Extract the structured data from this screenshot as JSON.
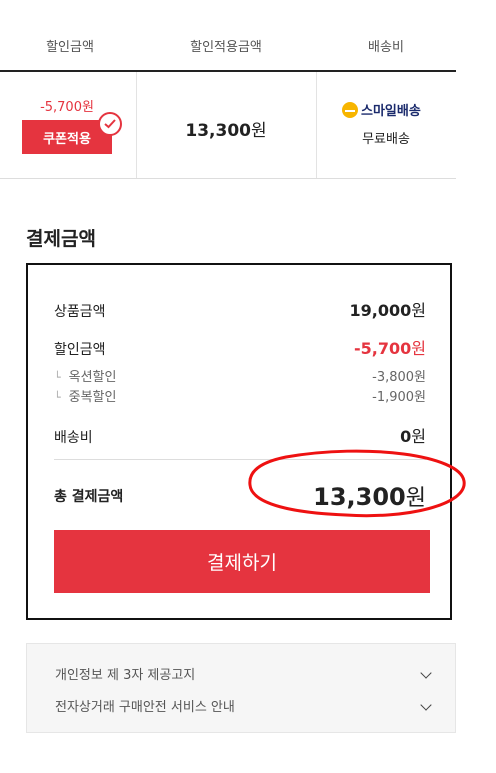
{
  "table": {
    "headers": [
      "할인금액",
      "할인적용금액",
      "배송비"
    ],
    "discount_amount": "-5,700원",
    "coupon_button": "쿠폰적용",
    "applied_amount_number": "13,300",
    "applied_amount_unit": "원",
    "shipping_brand": "스마일배송",
    "shipping_text": "무료배송"
  },
  "payment": {
    "title": "결제금액",
    "product_label": "상품금액",
    "product_number": "19,000",
    "discount_label": "할인금액",
    "discount_number": "-5,700",
    "sub_items": [
      {
        "label": "옥션할인",
        "value": "-3,800원"
      },
      {
        "label": "중복할인",
        "value": "-1,900원"
      }
    ],
    "shipping_label": "배송비",
    "shipping_number": "0",
    "unit": "원",
    "total_label": "총 결제금액",
    "total_number": "13,300",
    "pay_button": "결제하기"
  },
  "accordion": {
    "items": [
      "개인정보 제 3자 제공고지",
      "전자상거래 구매안전 서비스 안내"
    ]
  },
  "colors": {
    "accent": "#e5343f",
    "smile_logo": "#f7b500"
  }
}
